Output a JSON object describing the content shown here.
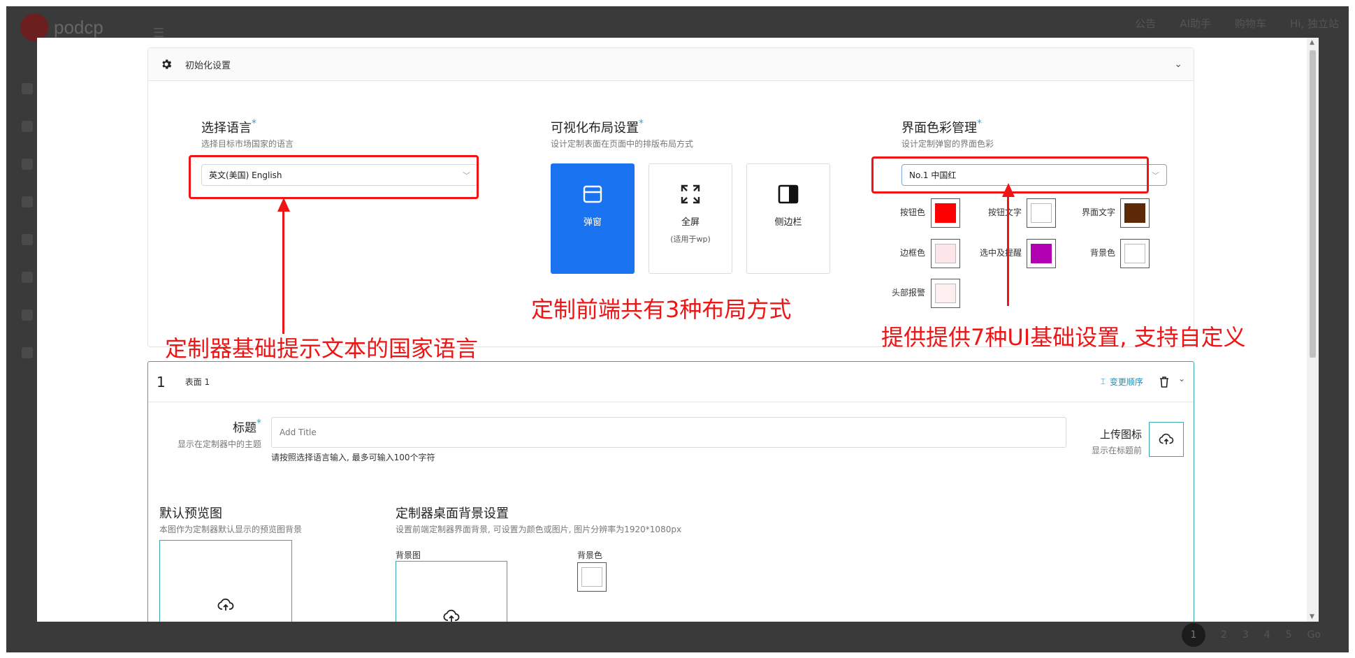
{
  "background": {
    "logo_text": "podcp",
    "topnav": [
      "公告",
      "AI助手",
      "购物车",
      "Hi, 独立站"
    ],
    "pager": [
      "1",
      "2",
      "3",
      "4",
      "5",
      "Go"
    ]
  },
  "init_card": {
    "title": "初始化设置",
    "language": {
      "title": "选择语言",
      "required_mark": "*",
      "subtitle": "选择目标市场国家的语言",
      "value": "英文(美国) English"
    },
    "layout": {
      "title": "可视化布局设置",
      "required_mark": "*",
      "subtitle": "设计定制表面在页面中的排版布局方式",
      "options": [
        {
          "label": "弹窗",
          "sublabel": "",
          "active": true
        },
        {
          "label": "全屏",
          "sublabel": "(适用于wp)",
          "active": false
        },
        {
          "label": "侧边栏",
          "sublabel": "",
          "active": false
        }
      ]
    },
    "colors": {
      "title": "界面色彩管理",
      "required_mark": "*",
      "subtitle": "设计定制弹窗的界面色彩",
      "theme_value": "No.1 中国红",
      "items": [
        {
          "label": "按钮色",
          "color": "#ff0000"
        },
        {
          "label": "按钮文字",
          "color": "#ffffff"
        },
        {
          "label": "界面文字",
          "color": "#5c2a06"
        },
        {
          "label": "边框色",
          "color": "#fde6ea"
        },
        {
          "label": "选中及提醒",
          "color": "#b300b3"
        },
        {
          "label": "背景色",
          "color": "#ffffff"
        },
        {
          "label": "头部报警",
          "color": "#fdeef0"
        }
      ]
    }
  },
  "surface_card": {
    "number": "1",
    "name": "表面 1",
    "reorder_label": "变更顺序",
    "title_field": {
      "label": "标题",
      "required_mark": "*",
      "sub": "显示在定制器中的主题",
      "placeholder": "Add Title",
      "hint": "请按照选择语言输入, 最多可输入100个字符"
    },
    "upload_icon": {
      "label": "上传图标",
      "sub": "显示在标题前"
    },
    "default_preview": {
      "title": "默认预览图",
      "sub": "本图作为定制器默认显示的预览图背景"
    },
    "desktop_bg": {
      "title": "定制器桌面背景设置",
      "sub": "设置前端定制器界面背景, 可设置为颜色或图片, 图片分辨率为1920*1080px",
      "image_label": "背景图",
      "color_label": "背景色"
    }
  },
  "annotations": {
    "language_note": "定制器基础提示文本的国家语言",
    "layout_note": "定制前端共有3种布局方式",
    "color_note": "提供提供7种UI基础设置, 支持自定义",
    "color": "#f01414"
  }
}
